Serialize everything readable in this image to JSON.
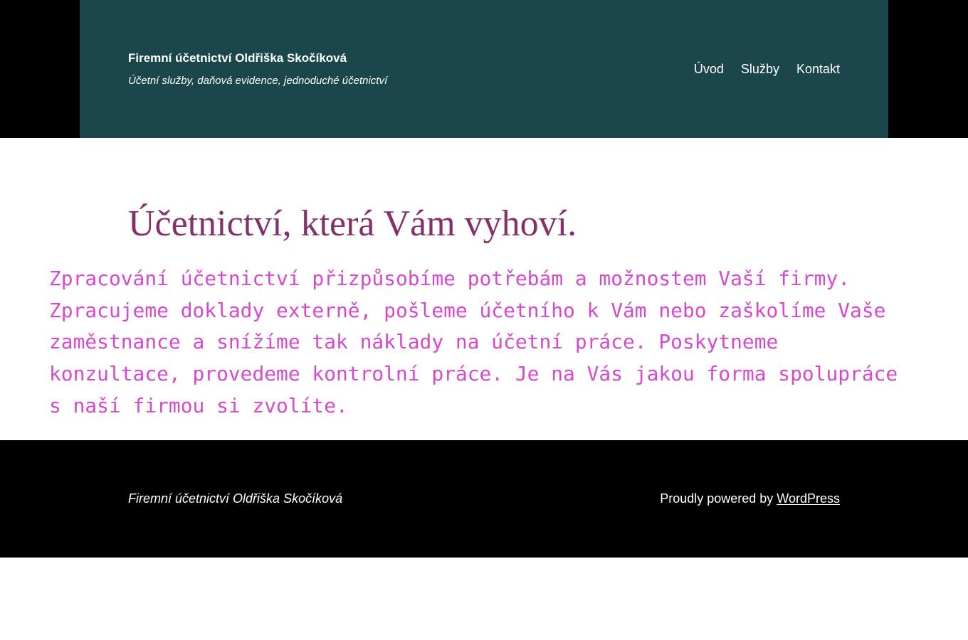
{
  "header": {
    "site_title": "Firemní účetnictví Oldřiška Skočíková",
    "tagline": "Účetní služby, daňová evidence, jednoduché účetnictví",
    "nav": [
      {
        "label": "Úvod"
      },
      {
        "label": "Služby"
      },
      {
        "label": "Kontakt"
      }
    ]
  },
  "main": {
    "heading": "Účetnictví, která Vám vyhoví.",
    "intro": "Zpracování účetnictví přizpůsobíme potřebám a možnostem Vaší firmy. Zpracujeme doklady externě, pošleme účetního k Vám nebo zaškolíme Vaše zaměstnance a snížíme tak náklady na účetní práce. Poskytneme konzultace, provedeme kontrolní práce. Je na Vás jakou forma spolupráce s naší firmou si zvolíte."
  },
  "footer": {
    "site_name": "Firemní účetnictví Oldřiška Skočíková",
    "credit_prefix": "Proudly powered by ",
    "credit_link": "WordPress"
  },
  "colors": {
    "header_bg": "#1b474c",
    "heading": "#84316b",
    "intro_text": "#d649cf",
    "footer_bg": "#000000"
  }
}
